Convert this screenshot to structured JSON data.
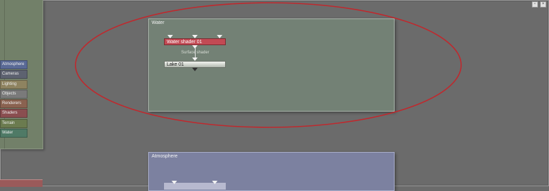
{
  "layers": [
    {
      "label": "Atmosphere",
      "color": "#5a6a96"
    },
    {
      "label": "Cameras",
      "color": "#5d6270"
    },
    {
      "label": "Lighting",
      "color": "#8e8360"
    },
    {
      "label": "Objects",
      "color": "#7a7a7a"
    },
    {
      "label": "Renderers",
      "color": "#8a6250"
    },
    {
      "label": "Shaders",
      "color": "#8a4e50"
    },
    {
      "label": "Terrain",
      "color": "#6b7b4f"
    },
    {
      "label": "Water",
      "color": "#4f7a66"
    }
  ],
  "graphs": {
    "water": {
      "title": "Water",
      "nodes": {
        "shader": "Water shader 01",
        "lake": "Lake 01"
      },
      "connection_label": "Surface shader"
    },
    "atmosphere": {
      "title": "Atmosphere"
    }
  },
  "window_controls": {
    "minimize": "▫",
    "close": "×"
  },
  "highlight_color": "#c0282d"
}
